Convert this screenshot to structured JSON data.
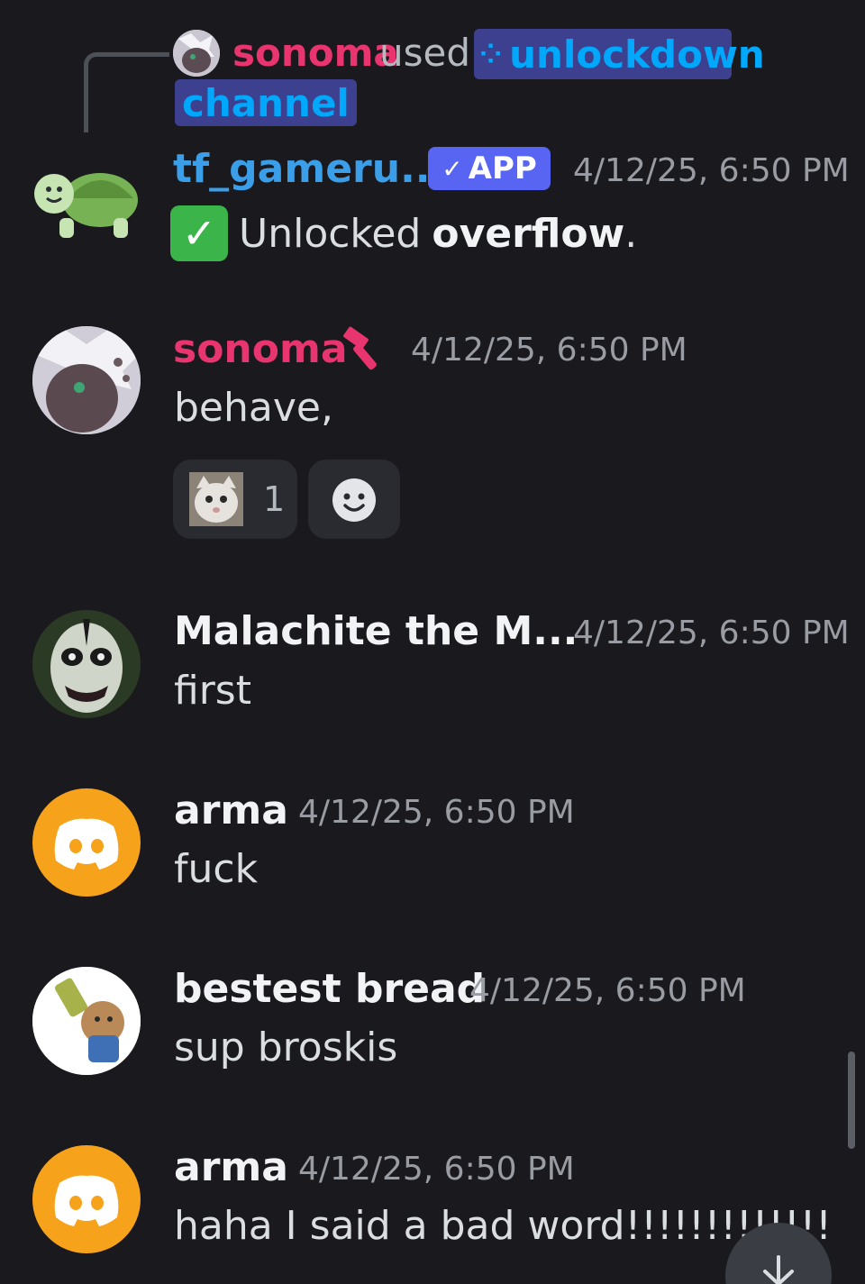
{
  "reply": {
    "username": "sonoma",
    "used_text": "used",
    "command": "unlockdown",
    "command_suffix": "channel"
  },
  "messages": [
    {
      "id": "m1",
      "username": "tf_gameru...",
      "badge": "APP",
      "timestamp": "4/12/25, 6:50 PM",
      "text_before": "Unlocked",
      "text_bold": "overflow",
      "text_after": ".",
      "name_color": "#3b9ee8"
    },
    {
      "id": "m2",
      "username": "sonoma",
      "timestamp": "4/12/25, 6:50 PM",
      "text": "behave,",
      "reaction_count": "1",
      "name_color": "#e8346f"
    },
    {
      "id": "m3",
      "username": "Malachite the M...",
      "timestamp": "4/12/25, 6:50 PM",
      "text": "first",
      "name_color": "#f2f3f5"
    },
    {
      "id": "m4",
      "username": "arma",
      "timestamp": "4/12/25, 6:50 PM",
      "text": "fuck",
      "name_color": "#f2f3f5"
    },
    {
      "id": "m5",
      "username": "bestest bread",
      "timestamp": "4/12/25, 6:50 PM",
      "text": "sup broskis",
      "name_color": "#f2f3f5"
    },
    {
      "id": "m6",
      "username": "arma",
      "timestamp": "4/12/25, 6:50 PM",
      "text": "haha I said a bad word!!!!!!!!!!!!!",
      "name_color": "#f2f3f5"
    }
  ],
  "colors": {
    "background": "#1a1a1e",
    "app_badge": "#5865f2",
    "discord_orange": "#f7a21b",
    "mention_bg": "#3d3f8f"
  }
}
